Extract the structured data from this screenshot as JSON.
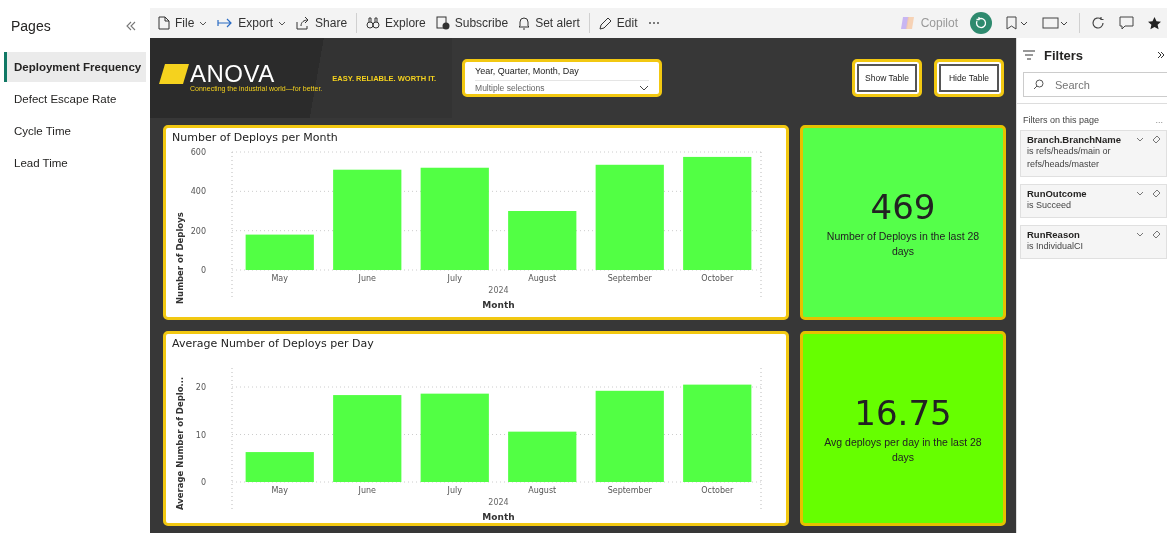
{
  "pages_panel": {
    "title": "Pages",
    "items": [
      {
        "label": "Deployment Frequency",
        "selected": true
      },
      {
        "label": "Defect Escape Rate",
        "selected": false
      },
      {
        "label": "Cycle Time",
        "selected": false
      },
      {
        "label": "Lead Time",
        "selected": false
      }
    ]
  },
  "toolbar": {
    "items": [
      {
        "label": "File",
        "dropdown": true
      },
      {
        "label": "Export",
        "dropdown": true
      },
      {
        "label": "Share",
        "dropdown": false
      },
      {
        "label": "Explore",
        "dropdown": false
      },
      {
        "label": "Subscribe",
        "dropdown": false
      },
      {
        "label": "Set alert",
        "dropdown": false
      },
      {
        "label": "Edit",
        "dropdown": false
      },
      {
        "label": "⋯",
        "dropdown": false
      }
    ],
    "copilot": "Copilot"
  },
  "report": {
    "logo": {
      "name": "ANOVA",
      "tagline": "Connecting the industrial world—for better.",
      "slogan": "EASY. RELIABLE. WORTH IT."
    },
    "slicer": {
      "title": "Year, Quarter, Month, Day",
      "value": "Multiple selections"
    },
    "buttons": [
      "Show Table",
      "Hide Table"
    ],
    "charts": [
      {
        "period": "2024",
        "chart_data": {
          "type": "bar",
          "title": "Number of Deploys per Month",
          "xlabel": "Month",
          "ylabel": "Number of Deploys",
          "categories": [
            "May",
            "June",
            "July",
            "August",
            "September",
            "October"
          ],
          "series": [
            {
              "color": "#52ff44",
              "values": [
                180,
                510,
                520,
                300,
                535,
                575
              ]
            }
          ],
          "ylim": [
            0,
            600
          ],
          "yticks": [
            0,
            200,
            400,
            600
          ]
        }
      },
      {
        "period": "2024",
        "chart_data": {
          "type": "bar",
          "title": "Average Number of Deploys per Day",
          "xlabel": "Month",
          "ylabel": "Average Number of Deplo...",
          "categories": [
            "May",
            "June",
            "July",
            "August",
            "September",
            "October"
          ],
          "series": [
            {
              "color": "#52ff44",
              "values": [
                6.3,
                18.3,
                18.6,
                10.6,
                19.2,
                20.5
              ]
            }
          ],
          "ylim": [
            0,
            24
          ],
          "yticks": [
            0,
            10,
            20
          ]
        }
      }
    ],
    "kpis": [
      {
        "value": "469",
        "label": "Number of Deploys in the last 28 days",
        "color": "#55ff4a"
      },
      {
        "value": "16.75",
        "label": "Avg deploys per day in the last 28 days",
        "color": "#66ff00"
      }
    ]
  },
  "filters": {
    "title": "Filters",
    "search": {
      "placeholder": "Search"
    },
    "section": "Filters on this page",
    "more": "...",
    "items": [
      {
        "field": "Branch.BranchName",
        "condition": "is refs/heads/main or refs/heads/master"
      },
      {
        "field": "RunOutcome",
        "condition": "is Succeed"
      },
      {
        "field": "RunReason",
        "condition": "is IndividualCI"
      }
    ]
  }
}
